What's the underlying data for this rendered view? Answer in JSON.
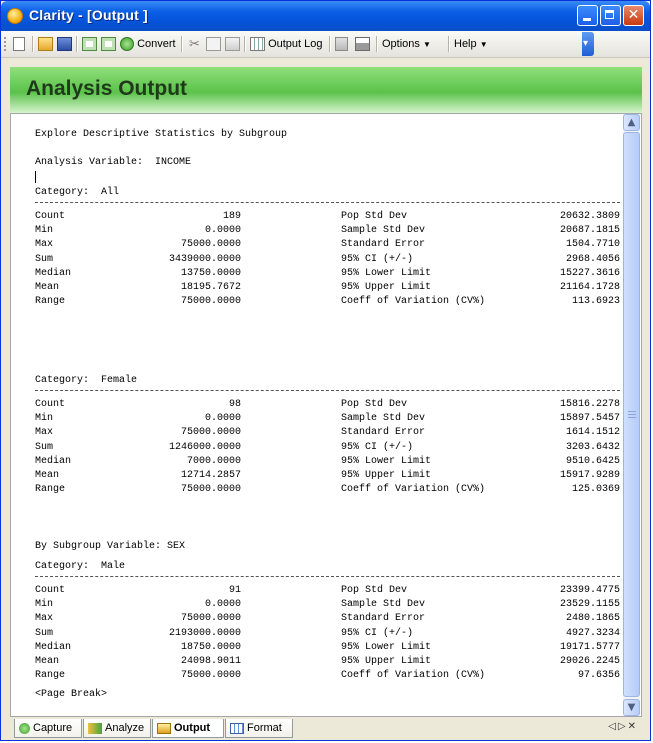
{
  "window": {
    "title": "Clarity - [Output ]"
  },
  "toolbar": {
    "convert_label": "Convert",
    "output_log_label": "Output Log",
    "options_label": "Options",
    "help_label": "Help"
  },
  "header": {
    "title": "Analysis Output"
  },
  "report": {
    "heading": "Explore Descriptive Statistics by Subgroup",
    "analysis_variable": "Analysis Variable:  INCOME",
    "subgroup_variable": "By Subgroup Variable: SEX",
    "page_break": "<Page Break>",
    "blocks": [
      {
        "category": "Category:  All",
        "rows": [
          [
            "Count",
            "189",
            "Pop Std Dev",
            "20632.3809"
          ],
          [
            "Min",
            "0.0000",
            "Sample Std Dev",
            "20687.1815"
          ],
          [
            "Max",
            "75000.0000",
            "Standard Error",
            "1504.7710"
          ],
          [
            "Sum",
            "3439000.0000",
            "95% CI (+/-)",
            "2968.4056"
          ],
          [
            "Median",
            "13750.0000",
            "95% Lower Limit",
            "15227.3616"
          ],
          [
            "Mean",
            "18195.7672",
            "95% Upper Limit",
            "21164.1728"
          ],
          [
            "Range",
            "75000.0000",
            "Coeff of Variation (CV%)",
            "113.6923"
          ]
        ]
      },
      {
        "category": "Category:  Female",
        "rows": [
          [
            "Count",
            "98",
            "Pop Std Dev",
            "15816.2278"
          ],
          [
            "Min",
            "0.0000",
            "Sample Std Dev",
            "15897.5457"
          ],
          [
            "Max",
            "75000.0000",
            "Standard Error",
            "1614.1512"
          ],
          [
            "Sum",
            "1246000.0000",
            "95% CI (+/-)",
            "3203.6432"
          ],
          [
            "Median",
            "7000.0000",
            "95% Lower Limit",
            "9510.6425"
          ],
          [
            "Mean",
            "12714.2857",
            "95% Upper Limit",
            "15917.9289"
          ],
          [
            "Range",
            "75000.0000",
            "Coeff of Variation (CV%)",
            "125.0369"
          ]
        ]
      },
      {
        "category": "Category:  Male",
        "rows": [
          [
            "Count",
            "91",
            "Pop Std Dev",
            "23399.4775"
          ],
          [
            "Min",
            "0.0000",
            "Sample Std Dev",
            "23529.1155"
          ],
          [
            "Max",
            "75000.0000",
            "Standard Error",
            "2480.1865"
          ],
          [
            "Sum",
            "2193000.0000",
            "95% CI (+/-)",
            "4927.3234"
          ],
          [
            "Median",
            "18750.0000",
            "95% Lower Limit",
            "19171.5777"
          ],
          [
            "Mean",
            "24098.9011",
            "95% Upper Limit",
            "29026.2245"
          ],
          [
            "Range",
            "75000.0000",
            "Coeff of Variation (CV%)",
            "97.6356"
          ]
        ]
      }
    ]
  },
  "tabs": [
    {
      "label": "Capture",
      "active": false
    },
    {
      "label": "Analyze",
      "active": false
    },
    {
      "label": "Output",
      "active": true
    },
    {
      "label": "Format",
      "active": false
    }
  ],
  "colors": {
    "titlebar": "#0553d8",
    "header_green": "#5bc24a",
    "close_red": "#c8390f"
  },
  "icons": [
    "app-icon",
    "new-icon",
    "open-icon",
    "save-icon",
    "export-icon",
    "export2-icon",
    "convert-icon",
    "cut-icon",
    "copy-icon",
    "paste-icon",
    "output-log-icon",
    "page-icon",
    "print-icon",
    "capture-icon",
    "analyze-icon",
    "output-icon",
    "format-icon"
  ]
}
